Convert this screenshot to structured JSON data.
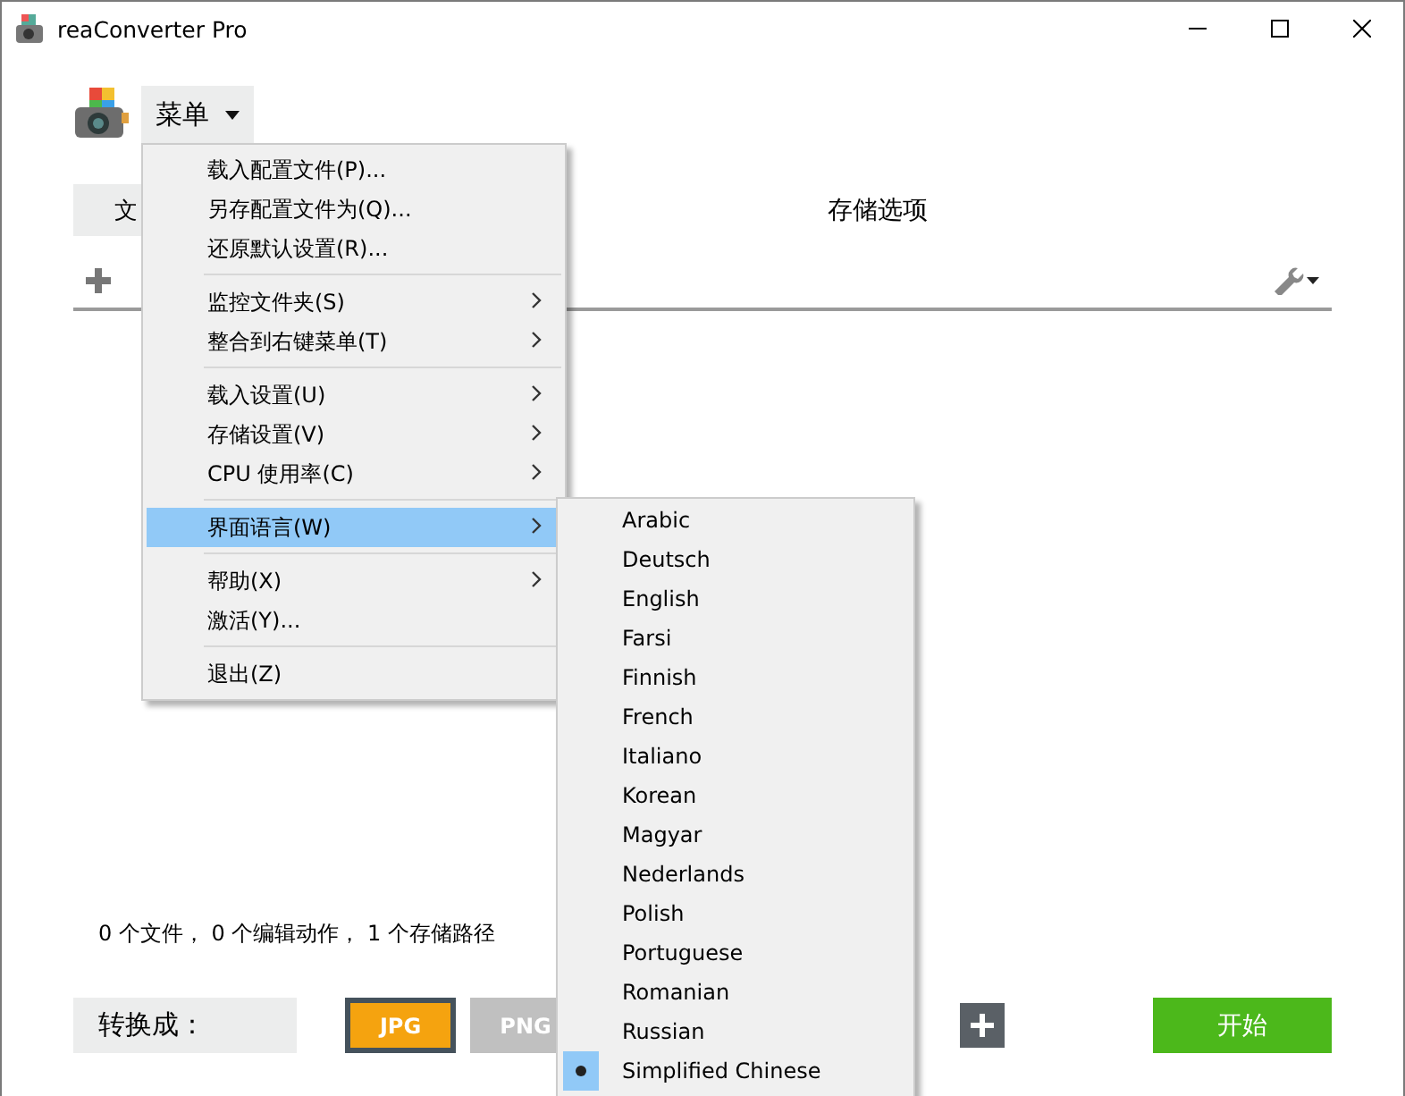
{
  "window": {
    "title": "reaConverter Pro"
  },
  "menu_button": {
    "label": "菜单"
  },
  "tabs": [
    {
      "label": "文",
      "selected": true
    },
    {
      "label": "存储选项",
      "selected": false
    }
  ],
  "status_text": "0 个文件， 0 个编辑动作， 1 个存储路径",
  "convert_label": "转换成：",
  "formats": [
    {
      "label": "JPG",
      "selected": true
    },
    {
      "label": "PNG",
      "selected": false
    }
  ],
  "start_button": {
    "label": "开始"
  },
  "menu": {
    "items": [
      {
        "kind": "item",
        "label": "载入配置文件(P)...",
        "submenu": false,
        "selected": false
      },
      {
        "kind": "item",
        "label": "另存配置文件为(Q)...",
        "submenu": false,
        "selected": false
      },
      {
        "kind": "item",
        "label": "还原默认设置(R)...",
        "submenu": false,
        "selected": false
      },
      {
        "kind": "separator"
      },
      {
        "kind": "item",
        "label": "监控文件夹(S)",
        "submenu": true,
        "selected": false
      },
      {
        "kind": "item",
        "label": "整合到右键菜单(T)",
        "submenu": true,
        "selected": false
      },
      {
        "kind": "separator"
      },
      {
        "kind": "item",
        "label": "载入设置(U)",
        "submenu": true,
        "selected": false
      },
      {
        "kind": "item",
        "label": "存储设置(V)",
        "submenu": true,
        "selected": false
      },
      {
        "kind": "item",
        "label": "CPU 使用率(C)",
        "submenu": true,
        "selected": false
      },
      {
        "kind": "separator"
      },
      {
        "kind": "item",
        "label": "界面语言(W)",
        "submenu": true,
        "selected": true
      },
      {
        "kind": "separator"
      },
      {
        "kind": "item",
        "label": "帮助(X)",
        "submenu": true,
        "selected": false
      },
      {
        "kind": "item",
        "label": "激活(Y)...",
        "submenu": false,
        "selected": false
      },
      {
        "kind": "separator"
      },
      {
        "kind": "item",
        "label": "退出(Z)",
        "submenu": false,
        "selected": false
      }
    ]
  },
  "language_menu": {
    "items": [
      {
        "label": "Arabic",
        "checked": false
      },
      {
        "label": "Deutsch",
        "checked": false
      },
      {
        "label": "English",
        "checked": false
      },
      {
        "label": "Farsi",
        "checked": false
      },
      {
        "label": "Finnish",
        "checked": false
      },
      {
        "label": "French",
        "checked": false
      },
      {
        "label": "Italiano",
        "checked": false
      },
      {
        "label": "Korean",
        "checked": false
      },
      {
        "label": "Magyar",
        "checked": false
      },
      {
        "label": "Nederlands",
        "checked": false
      },
      {
        "label": "Polish",
        "checked": false
      },
      {
        "label": "Portuguese",
        "checked": false
      },
      {
        "label": "Romanian",
        "checked": false
      },
      {
        "label": "Russian",
        "checked": false
      },
      {
        "label": "Simplified Chinese",
        "checked": true
      }
    ]
  }
}
